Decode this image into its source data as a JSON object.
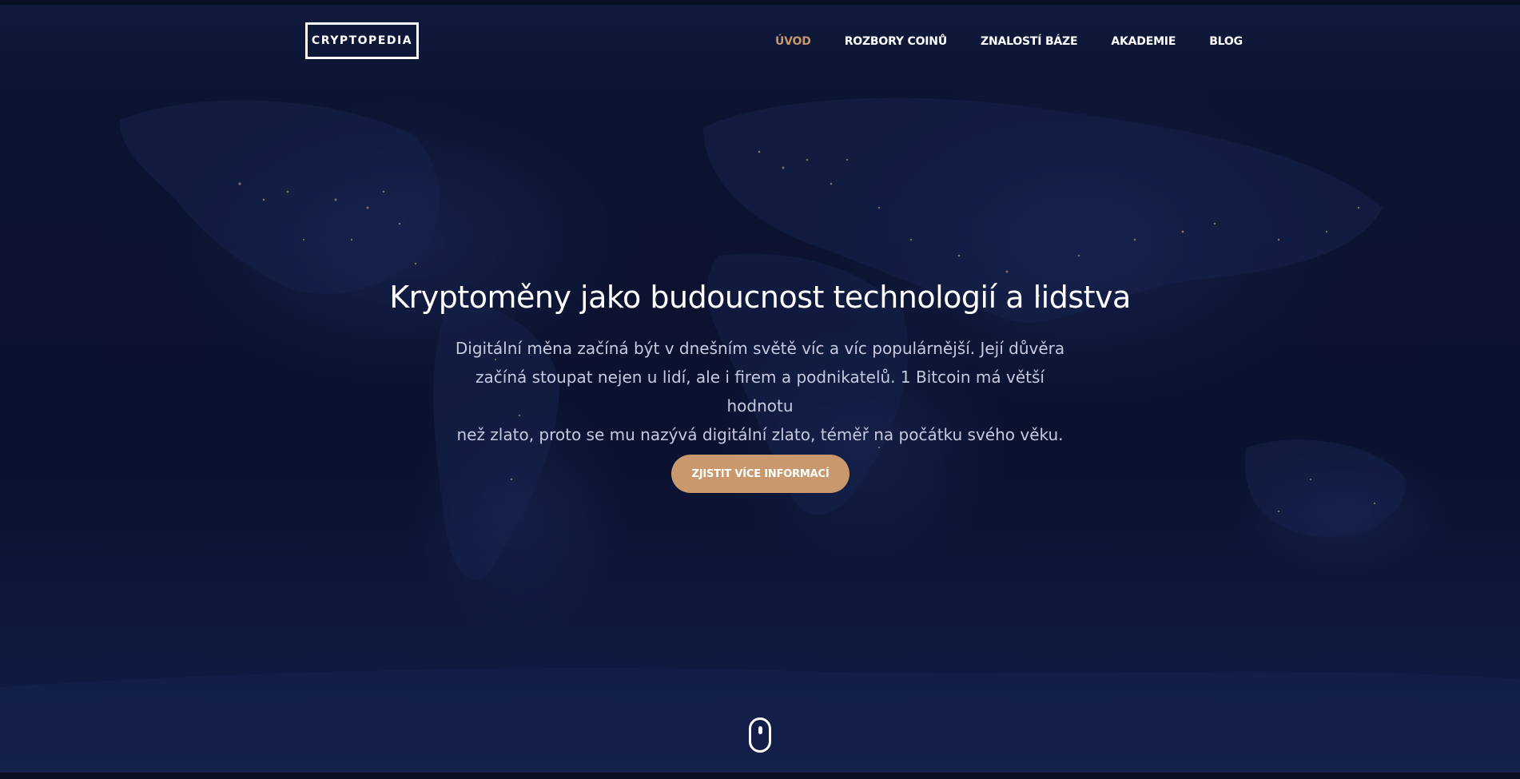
{
  "logo": {
    "text": "CRYPTOPEDIA"
  },
  "nav": {
    "items": [
      {
        "label": "ÚVOD",
        "active": true
      },
      {
        "label": "ROZBORY COINŮ",
        "active": false
      },
      {
        "label": "ZNALOSTÍ BÁZE",
        "active": false
      },
      {
        "label": "AKADEMIE",
        "active": false
      },
      {
        "label": "BLOG",
        "active": false
      }
    ]
  },
  "hero": {
    "title": "Kryptoměny jako budoucnost technologií a lidstva",
    "lines": [
      "Digitální měna začíná být v dnešním světě víc a víc populárnější. Její důvěra",
      "začíná stoupat nejen u lidí, ale i firem a podnikatelů. 1 Bitcoin má větší hodnotu",
      "než zlato, proto se mu nazývá digitální zlato, téměř na počátku svého věku."
    ],
    "cta_label": "ZJISTIT VÍCE INFORMACÍ"
  },
  "colors": {
    "background": "#0c1230",
    "accent": "#c9996d",
    "active_nav": "#c9966b",
    "text": "#ffffff",
    "muted_text": "#c7cadf"
  },
  "icons": {
    "background": "world-map-night-lights",
    "scroll": "mouse-scroll-icon"
  }
}
